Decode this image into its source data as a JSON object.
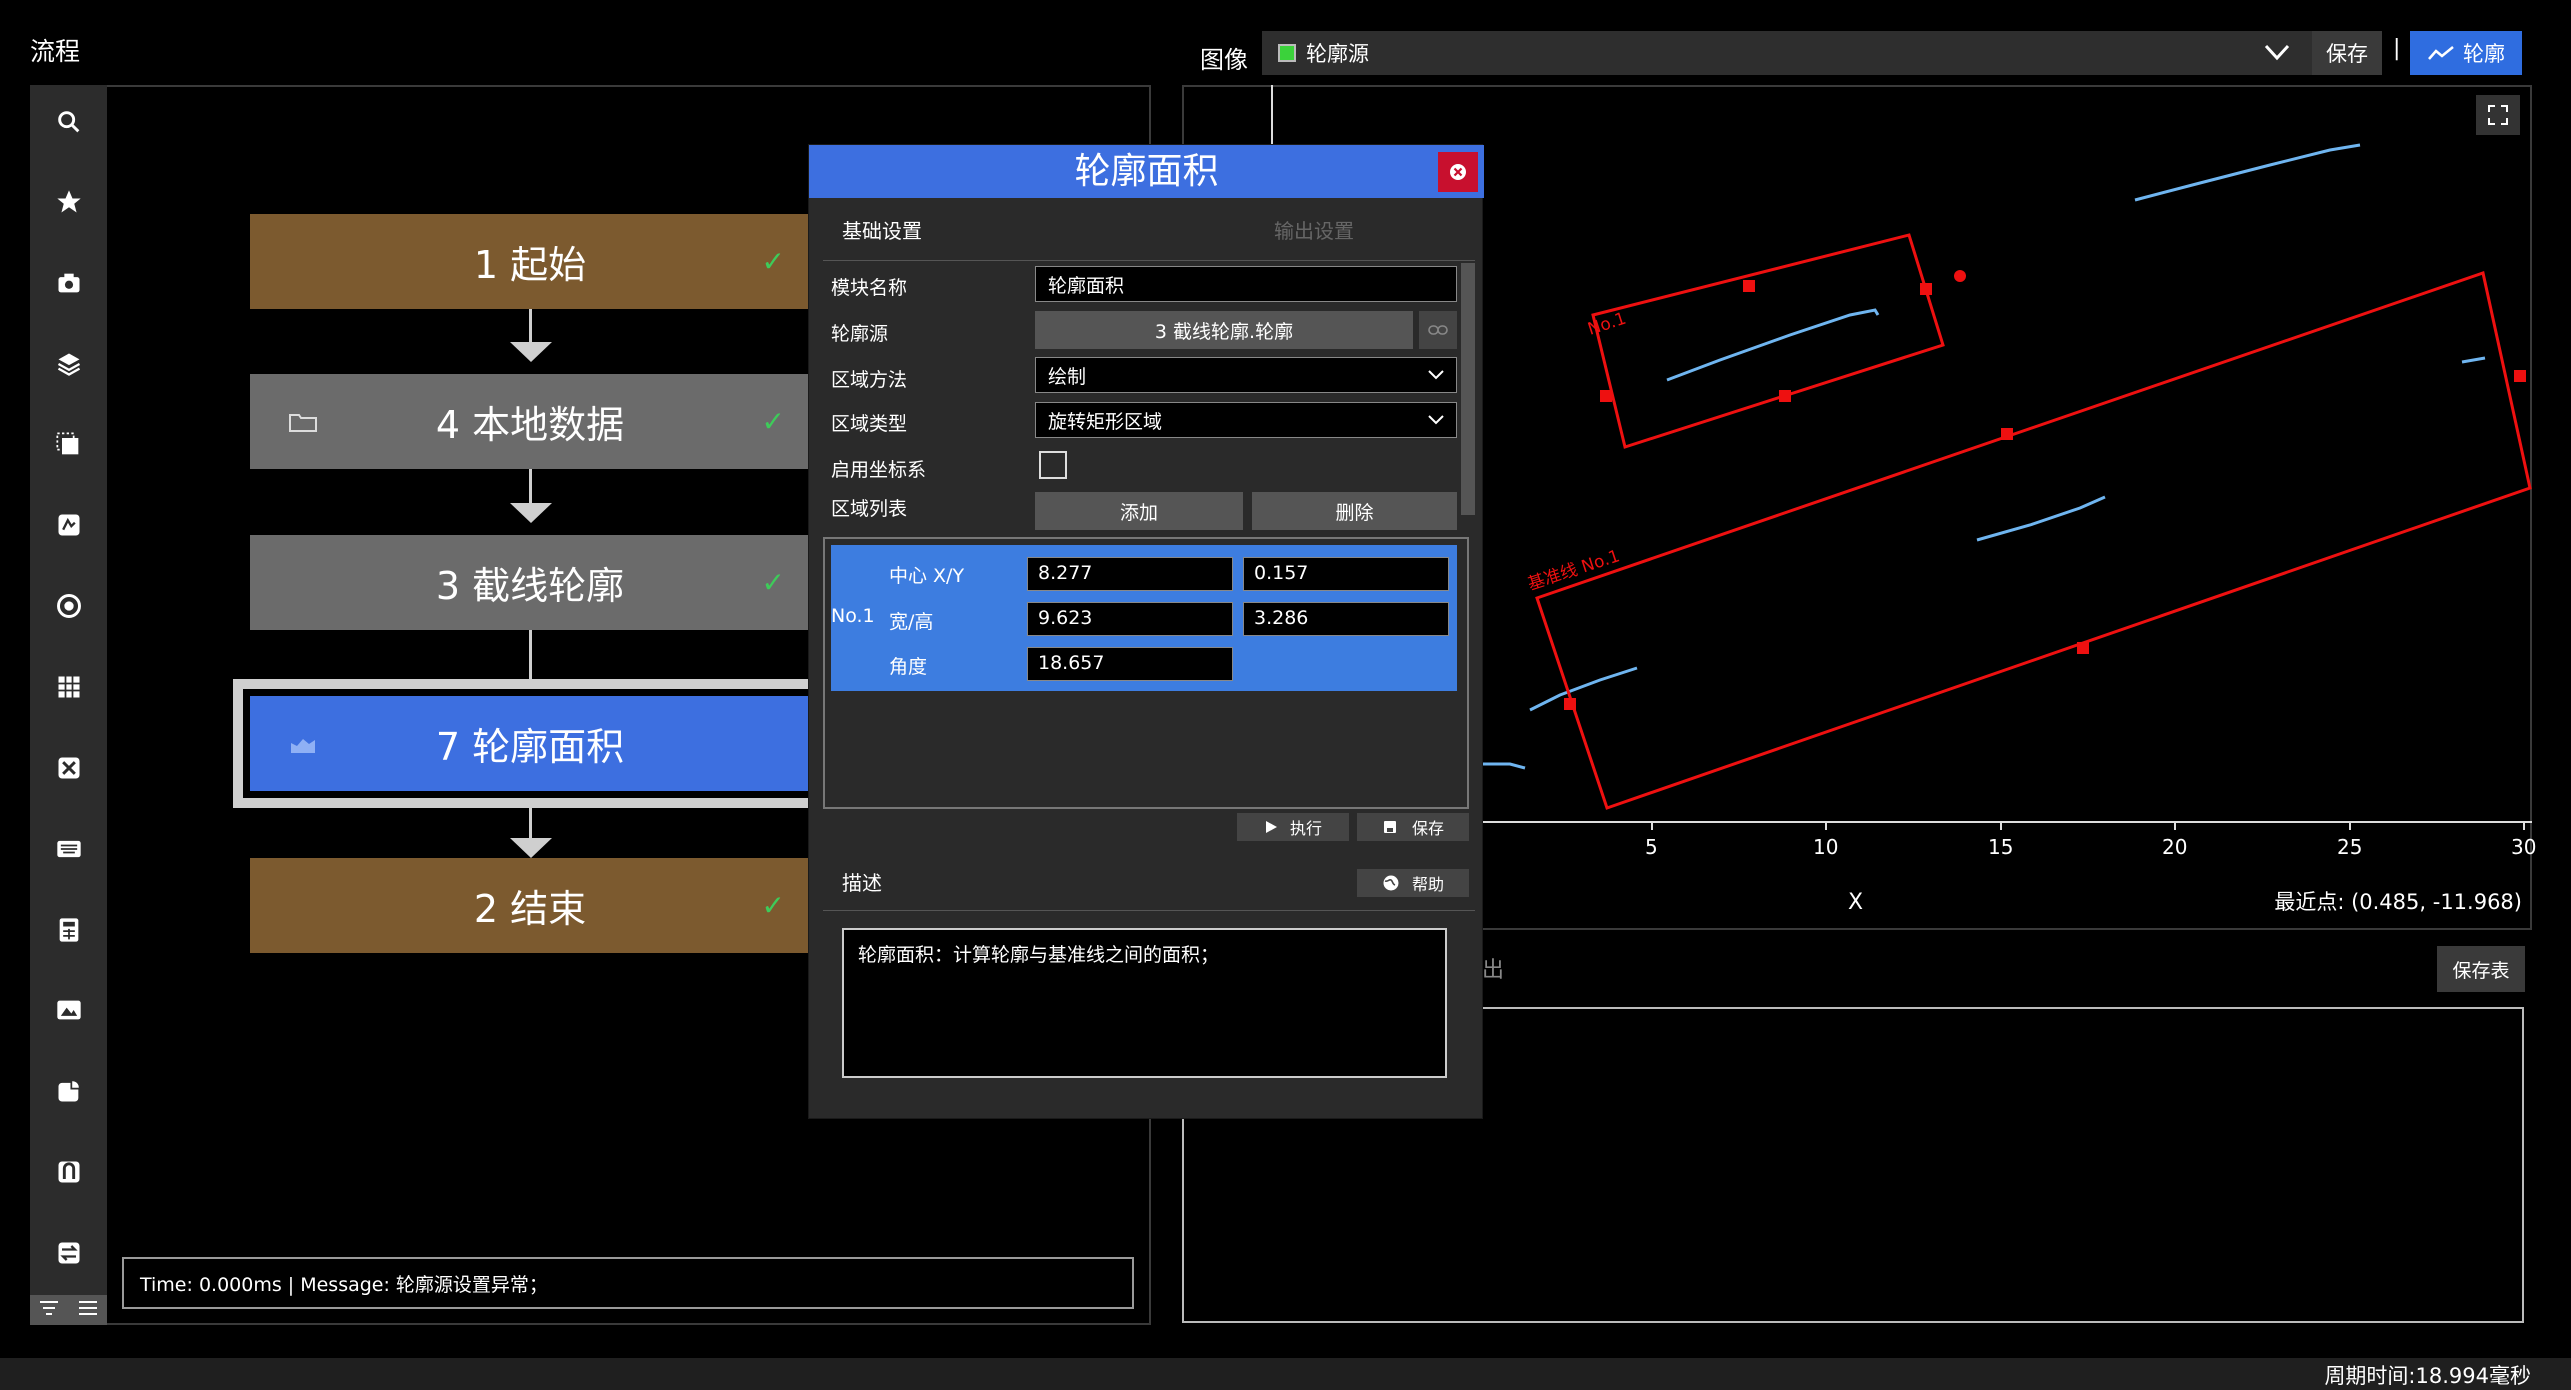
{
  "left": {
    "title": "流程",
    "nodes": [
      {
        "label": "1 起始",
        "check": "✓"
      },
      {
        "label": "4 本地数据",
        "check": "✓"
      },
      {
        "label": "3 截线轮廓",
        "check": "✓"
      },
      {
        "label": "7 轮廓面积"
      },
      {
        "label": "2 结束",
        "check": "✓"
      }
    ],
    "status": "Time: 0.000ms |  Message: 轮廓源设置异常；"
  },
  "right": {
    "image_label": "图像",
    "source_select": "轮廓源",
    "save_label": "保存",
    "pipe": "|",
    "contour_label": "轮廓",
    "save_table_label": "保存表",
    "output_tab_partial": "出",
    "nearest_point": "最近点: (0.485, -11.968)",
    "x_axis_label": "X",
    "x_ticks": [
      "5",
      "10",
      "15",
      "20",
      "25",
      "30"
    ],
    "annot_no1": "No.1",
    "annot_baseline": "基准线 No.1"
  },
  "dialog": {
    "title": "轮廓面积",
    "tab_basic": "基础设置",
    "tab_output": "输出设置",
    "labels": {
      "module_name": "模块名称",
      "contour_source": "轮廓源",
      "region_method": "区域方法",
      "region_type": "区域类型",
      "enable_coord": "启用坐标系",
      "region_list": "区域列表"
    },
    "values": {
      "module_name": "轮廓面积",
      "contour_source": "3 截线轮廓.轮廓",
      "region_method": "绘制",
      "region_type": "旋转矩形区域"
    },
    "add_label": "添加",
    "delete_label": "删除",
    "region": {
      "id": "No.1",
      "center_label": "中心 X/Y",
      "size_label": "宽/高",
      "angle_label": "角度",
      "center_x": "8.277",
      "center_y": "0.157",
      "width": "9.623",
      "height": "3.286",
      "angle": "18.657"
    },
    "run_label": "执行",
    "save_label": "保存",
    "desc_heading": "描述",
    "help_label": "帮助",
    "description": "轮廓面积：计算轮廓与基准线之间的面积；"
  },
  "footer": {
    "cycle_time": "周期时间:18.994毫秒"
  }
}
